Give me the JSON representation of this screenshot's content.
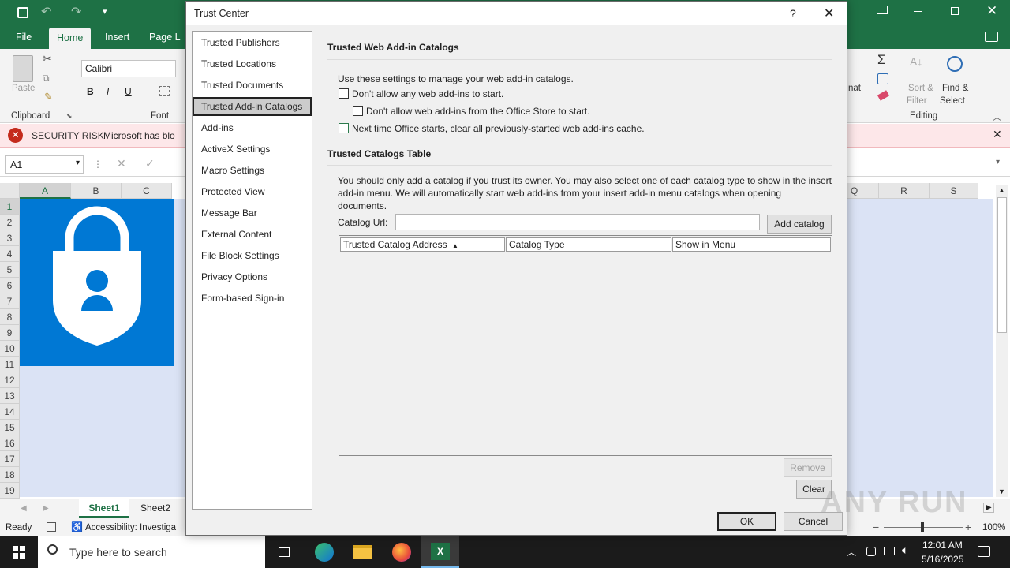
{
  "excel": {
    "tabs": [
      "File",
      "Home",
      "Insert",
      "Page L"
    ],
    "active_tab": "Home",
    "font_name": "Calibri",
    "bold": "B",
    "italic": "I",
    "underline": "U",
    "paste_label": "Paste",
    "clipboard_label": "Clipboard",
    "font_label": "Font",
    "editing_label": "Editing",
    "format_label_fragment": "nat",
    "sort_filter_l1": "Sort &",
    "sort_filter_l2": "Filter",
    "find_select_l1": "Find &",
    "find_select_l2": "Select",
    "security_risk_label": "SECURITY RISK",
    "security_risk_text": "Microsoft has blo",
    "name_box": "A1",
    "columns_left": [
      "A",
      "B",
      "C"
    ],
    "columns_right": [
      "Q",
      "R",
      "S"
    ],
    "rows": [
      "1",
      "2",
      "3",
      "4",
      "5",
      "6",
      "7",
      "8",
      "9",
      "10",
      "11",
      "12",
      "13",
      "14",
      "15",
      "16",
      "17",
      "18",
      "19"
    ],
    "sheets": [
      "Sheet1",
      "Sheet2"
    ],
    "active_sheet": "Sheet1",
    "status_ready": "Ready",
    "accessibility": "Accessibility: Investiga",
    "zoom": "100%",
    "colors": {
      "excel_green": "#1e7145",
      "shield_blue": "#0078d4",
      "security_red": "#c42b1c"
    }
  },
  "dialog": {
    "title": "Trust Center",
    "help": "?",
    "nav": [
      "Trusted Publishers",
      "Trusted Locations",
      "Trusted Documents",
      "Trusted Add-in Catalogs",
      "Add-ins",
      "ActiveX Settings",
      "Macro Settings",
      "Protected View",
      "Message Bar",
      "External Content",
      "File Block Settings",
      "Privacy Options",
      "Form-based Sign-in"
    ],
    "selected_nav": "Trusted Add-in Catalogs",
    "section1_title": "Trusted Web Add-in Catalogs",
    "section1_desc": "Use these settings to manage your web add-in catalogs.",
    "opt1": "Don't allow any web add-ins to start.",
    "opt2": "Don't allow web add-ins from the Office Store to start.",
    "opt3": "Next time Office starts, clear all previously-started web add-ins cache.",
    "section2_title": "Trusted Catalogs Table",
    "section2_desc_l1": "You should only add a catalog if you trust its owner. You may also select one of each catalog type to show in the insert",
    "section2_desc_l2": "add-in menu. We will automatically start web add-ins from your insert add-in menu catalogs when opening",
    "section2_desc_l3": "documents.",
    "catalog_url_label": "Catalog Url:",
    "catalog_url_value": "",
    "add_catalog": "Add catalog",
    "table_headers": [
      "Trusted Catalog Address",
      "Catalog Type",
      "Show in Menu"
    ],
    "remove": "Remove",
    "clear": "Clear",
    "ok": "OK",
    "cancel": "Cancel"
  },
  "taskbar": {
    "search_placeholder": "Type here to search",
    "time": "12:01 AM",
    "date": "5/16/2025"
  },
  "watermark": "ANY RUN"
}
